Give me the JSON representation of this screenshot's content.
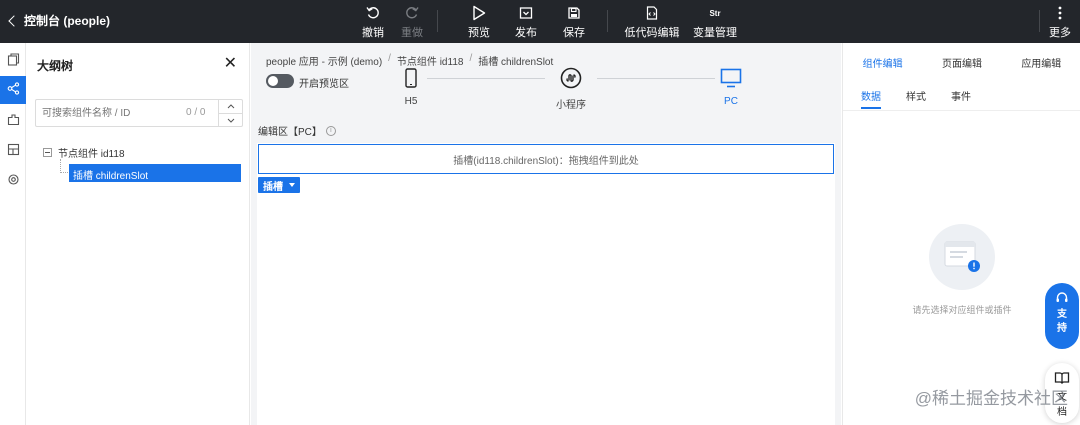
{
  "topbar": {
    "back_label": "控制台 (people)",
    "tools": [
      {
        "label": "撤销",
        "icon": "undo-icon",
        "disabled": false
      },
      {
        "label": "重做",
        "icon": "redo-icon",
        "disabled": true
      },
      {
        "label": "预览",
        "icon": "play-icon",
        "disabled": false
      },
      {
        "label": "发布",
        "icon": "publish-icon",
        "disabled": false
      },
      {
        "label": "保存",
        "icon": "save-icon",
        "disabled": false
      },
      {
        "label": "低代码编辑",
        "icon": "code-file-icon",
        "disabled": false
      },
      {
        "label": "变量管理",
        "icon": "variable-icon",
        "icon_text": "Str",
        "disabled": false
      }
    ],
    "more_label": "更多"
  },
  "strip": {
    "icons": [
      "pages-icon",
      "outline-tree-icon",
      "components-icon",
      "layout-icon",
      "settings-icon"
    ],
    "active_index": 1
  },
  "outline": {
    "title": "大纲树",
    "search_placeholder": "可搜索组件名称 / ID",
    "search_count": "0 / 0",
    "node_label": "节点组件 id118",
    "child_label": "插槽 childrenSlot"
  },
  "center": {
    "breadcrumb": [
      "people 应用 - 示例 (demo)",
      "节点组件 id118",
      "插槽 childrenSlot"
    ],
    "preview_toggle_label": "开启预览区",
    "devices": [
      {
        "label": "H5",
        "icon": "mobile-icon",
        "active": false
      },
      {
        "label": "小程序",
        "icon": "miniprogram-icon",
        "active": false
      },
      {
        "label": "PC",
        "icon": "monitor-icon",
        "active": true
      }
    ],
    "edit_area_label": "编辑区【PC】",
    "slot_hint": "插槽(id118.childrenSlot)：拖拽组件到此处",
    "slot_tag_label": "插槽"
  },
  "right": {
    "tabs": [
      {
        "label": "组件编辑",
        "active": true
      },
      {
        "label": "页面编辑",
        "active": false
      },
      {
        "label": "应用编辑",
        "active": false
      }
    ],
    "subtabs": [
      {
        "label": "数据",
        "active": true
      },
      {
        "label": "样式",
        "active": false
      },
      {
        "label": "事件",
        "active": false
      }
    ],
    "empty_text": "请先选择对应组件或插件",
    "support_label": [
      "支",
      "持"
    ],
    "doc_label": [
      "文",
      "档"
    ]
  },
  "watermark": "@稀土掘金技术社区",
  "colors": {
    "accent": "#1a73e8",
    "topbar_bg": "#23262b"
  }
}
